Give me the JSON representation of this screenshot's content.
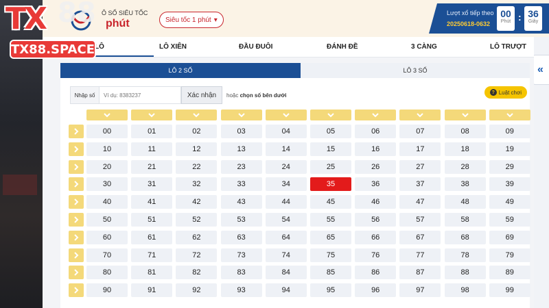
{
  "logo": {
    "mark": "TX",
    "digits": "88",
    "site": "TX88.SPACE"
  },
  "header": {
    "game_subtitle": "Ô SỐ SIÊU TỐC",
    "game_title": "phút",
    "speed_select": "Siêu tốc 1 phút",
    "next_draw_label": "Lượt xổ tiếp theo",
    "draw_id": "20250618-0632",
    "timer": {
      "minutes": "00",
      "minutes_unit": "Phút",
      "seconds": "36",
      "seconds_unit": "Giây"
    }
  },
  "nav": {
    "items": [
      "LÔ",
      "LÔ XIÊN",
      "ĐẦU ĐUÔI",
      "ĐÁNH ĐỀ",
      "3 CÀNG",
      "LÔ TRƯỢT"
    ],
    "active": 0
  },
  "subtabs": [
    "LÔ 2 SỐ",
    "LÔ 3 SỐ"
  ],
  "input": {
    "label": "Nhập số",
    "placeholder": "Ví dụ: 8383237",
    "confirm": "Xác nhận"
  },
  "hint": {
    "prefix": "hoặc",
    "text": "chọn số bên dưới"
  },
  "rules_button": "Luật chơi",
  "grid": {
    "rows": [
      [
        "00",
        "01",
        "02",
        "03",
        "04",
        "05",
        "06",
        "07",
        "08",
        "09"
      ],
      [
        "10",
        "11",
        "12",
        "13",
        "14",
        "15",
        "16",
        "17",
        "18",
        "19"
      ],
      [
        "20",
        "21",
        "22",
        "23",
        "24",
        "25",
        "26",
        "27",
        "28",
        "29"
      ],
      [
        "30",
        "31",
        "32",
        "33",
        "34",
        "35",
        "36",
        "37",
        "38",
        "39"
      ],
      [
        "40",
        "41",
        "42",
        "43",
        "44",
        "45",
        "46",
        "47",
        "48",
        "49"
      ],
      [
        "50",
        "51",
        "52",
        "53",
        "54",
        "55",
        "56",
        "57",
        "58",
        "59"
      ],
      [
        "60",
        "61",
        "62",
        "63",
        "64",
        "65",
        "66",
        "67",
        "68",
        "69"
      ],
      [
        "70",
        "71",
        "72",
        "73",
        "74",
        "75",
        "76",
        "77",
        "78",
        "79"
      ],
      [
        "80",
        "81",
        "82",
        "83",
        "84",
        "85",
        "86",
        "87",
        "88",
        "89"
      ],
      [
        "90",
        "91",
        "92",
        "93",
        "94",
        "95",
        "96",
        "97",
        "98",
        "99"
      ]
    ],
    "selected": [
      "35"
    ]
  },
  "colors": {
    "primary": "#1b4f95",
    "accent": "#c8242b",
    "selected": "#e31b1b",
    "toggle": "#f4d97a",
    "brand": "#e83a37"
  }
}
